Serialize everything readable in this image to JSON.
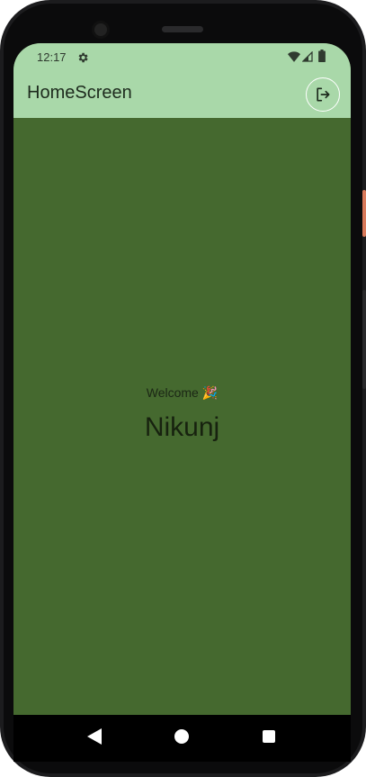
{
  "status_bar": {
    "time": "12:17",
    "icons": [
      "settings-icon",
      "wifi-icon",
      "signal-icon",
      "battery-icon"
    ]
  },
  "app_bar": {
    "title": "HomeScreen",
    "action_icon": "logout-icon"
  },
  "main": {
    "welcome_text": "Welcome",
    "welcome_emoji": "🎉",
    "user_name": "Nikunj"
  },
  "nav_bar": {
    "buttons": [
      "back-icon",
      "home-icon",
      "recents-icon"
    ]
  },
  "colors": {
    "app_bar_bg": "#a9d8a9",
    "content_bg": "#45692f",
    "nav_bar_bg": "#000000"
  }
}
